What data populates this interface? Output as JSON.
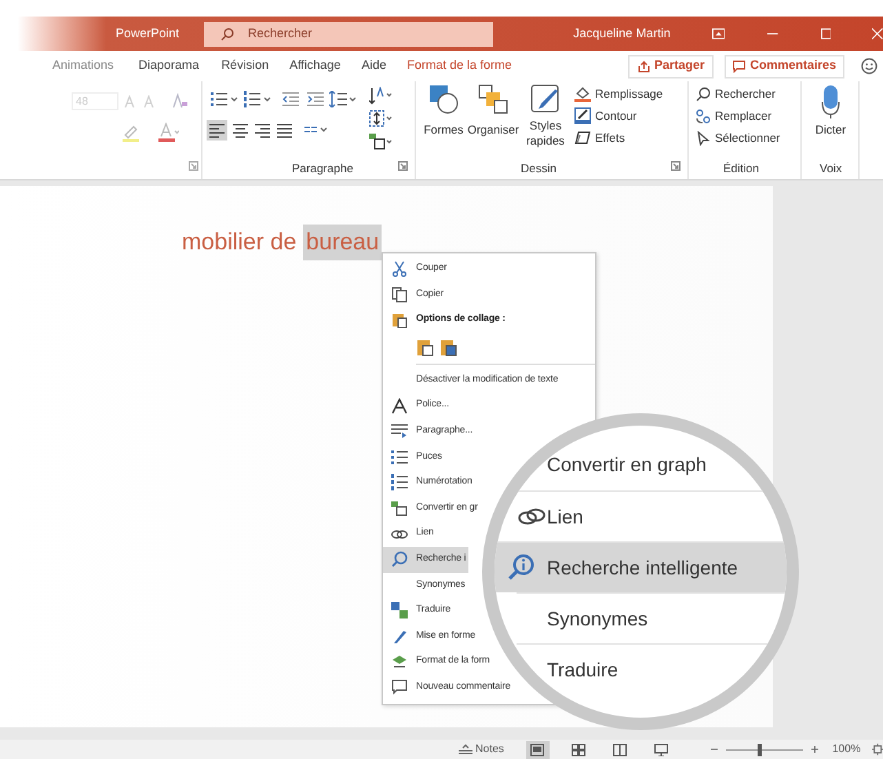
{
  "title_bar": {
    "title": "PowerPoint",
    "search_placeholder": "Rechercher",
    "user": "Jacqueline Martin"
  },
  "tabs": [
    {
      "label": "Animations",
      "kind": "faded"
    },
    {
      "label": "Diaporama",
      "kind": "normal"
    },
    {
      "label": "Révision",
      "kind": "normal"
    },
    {
      "label": "Affichage",
      "kind": "normal"
    },
    {
      "label": "Aide",
      "kind": "normal"
    },
    {
      "label": "Format de la forme",
      "kind": "contextual"
    }
  ],
  "share_button": "Partager",
  "comments_button": "Commentaires",
  "ribbon": {
    "font_size": "48",
    "paragraph_label": "Paragraphe",
    "drawing": {
      "label": "Dessin",
      "shapes": "Formes",
      "arrange": "Organiser",
      "quick_styles": "Styles rapides",
      "fill": "Remplissage",
      "outline": "Contour",
      "effects": "Effets"
    },
    "editing": {
      "label": "Édition",
      "find": "Rechercher",
      "replace": "Remplacer",
      "select": "Sélectionner"
    },
    "voice": {
      "label": "Voix",
      "dictate": "Dicter"
    }
  },
  "slide": {
    "words": [
      {
        "text": "mobilier de",
        "selected": false
      },
      {
        "text": "bureau",
        "selected": true
      }
    ]
  },
  "context_menu": [
    {
      "kind": "item",
      "label": "Couper",
      "selected": false
    },
    {
      "kind": "item",
      "label": "Copier",
      "selected": false
    },
    {
      "kind": "header",
      "label": "Options de collage :",
      "selected": false
    },
    {
      "kind": "paste_options",
      "selected": false
    },
    {
      "kind": "separator",
      "selected": false
    },
    {
      "kind": "item",
      "label": "Désactiver la modification de texte",
      "selected": false
    },
    {
      "kind": "item",
      "label": "Police...",
      "selected": false
    },
    {
      "kind": "item",
      "label": "Paragraphe...",
      "selected": false
    },
    {
      "kind": "item",
      "label": "Puces",
      "selected": false
    },
    {
      "kind": "item",
      "label": "Numérotation",
      "selected": false
    },
    {
      "kind": "item",
      "label": "Convertir en gr",
      "selected": false
    },
    {
      "kind": "item",
      "label": "Lien",
      "selected": false
    },
    {
      "kind": "item",
      "label": "Recherche i",
      "selected": true
    },
    {
      "kind": "item",
      "label": "Synonymes",
      "selected": false
    },
    {
      "kind": "item",
      "label": "Traduire",
      "selected": false
    },
    {
      "kind": "item",
      "label": "Mise en forme",
      "selected": false
    },
    {
      "kind": "item",
      "label": "Format de la form",
      "selected": false
    },
    {
      "kind": "item",
      "label": "Nouveau commentaire",
      "selected": false
    }
  ],
  "magnifier": [
    {
      "label": "Convertir en graph",
      "selected": false
    },
    {
      "label": "Lien",
      "selected": false
    },
    {
      "label": "Recherche intelligente",
      "selected": true
    },
    {
      "label": "Synonymes",
      "selected": false
    },
    {
      "label": "Traduire",
      "selected": false
    }
  ],
  "status_bar": {
    "notes": "Notes",
    "views": [
      {
        "selected": true
      },
      {
        "selected": false
      },
      {
        "selected": false
      },
      {
        "selected": false
      }
    ],
    "zoom": {
      "level": 0.43
    },
    "zoom_reading": "100%"
  }
}
